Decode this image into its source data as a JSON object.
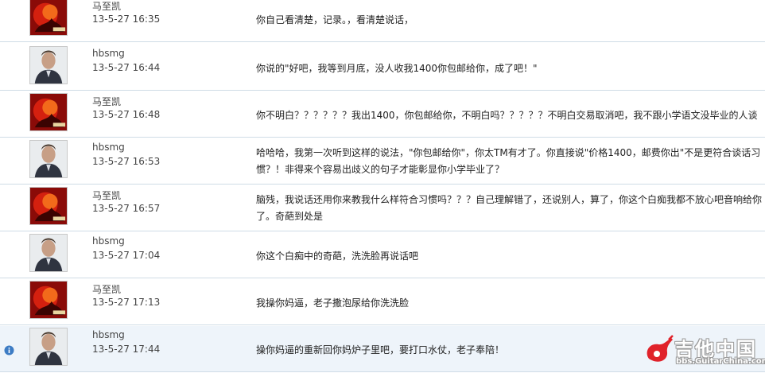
{
  "messages": [
    {
      "sender": "马至凯",
      "time": "13-5-27 16:35",
      "text": "你自己看清楚，记录。，看清楚说话，",
      "avatar": "red-fire-avatar"
    },
    {
      "sender": "hbsmg",
      "time": "13-5-27 16:44",
      "text": "你说的\"好吧，我等到月底，没人收我1400你包邮给你，成了吧！\"",
      "avatar": "man-portrait-avatar"
    },
    {
      "sender": "马至凯",
      "time": "13-5-27 16:48",
      "text": "你不明白？？？？？？我出1400，你包邮给你，不明白吗？？？？？不明白交易取消吧，我不跟小学语文没毕业的人谈",
      "avatar": "red-fire-avatar"
    },
    {
      "sender": "hbsmg",
      "time": "13-5-27 16:53",
      "text": "哈哈哈，我第一次听到这样的说法，\"你包邮给你\"，你太TM有才了。你直接说\"价格1400，邮费你出\"不是更符合谈话习惯？！非得来个容易出歧义的句子才能彰显你小学毕业了？",
      "avatar": "man-portrait-avatar"
    },
    {
      "sender": "马至凯",
      "time": "13-5-27 16:57",
      "text": "脑残，我说话还用你来教我什么样符合习惯吗？？？自己理解错了，还说别人，算了，你这个白痴我都不放心吧音响给你了。奇葩到处是",
      "avatar": "red-fire-avatar"
    },
    {
      "sender": "hbsmg",
      "time": "13-5-27 17:04",
      "text": "你这个白痴中的奇葩，洗洗脸再说话吧",
      "avatar": "man-portrait-avatar"
    },
    {
      "sender": "马至凯",
      "time": "13-5-27 17:13",
      "text": "我操你妈逼，老子撒泡尿给你洗洗脸",
      "avatar": "red-fire-avatar"
    },
    {
      "sender": "hbsmg",
      "time": "13-5-27 17:44",
      "text": "操你妈逼的重新回你妈炉子里吧，要打口水仗，老子奉陪！",
      "avatar": "man-portrait-avatar"
    }
  ],
  "watermark": {
    "logo_text": "吉他中国",
    "url": "bbs.GuitarChina.com"
  },
  "colors": {
    "row_border": "#cfdce6",
    "highlight_row": "#eef4fa",
    "info_icon": "#3d7cc4"
  }
}
